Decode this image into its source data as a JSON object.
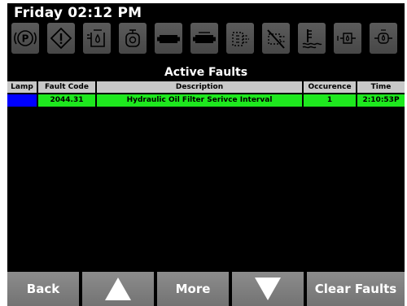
{
  "status": {
    "time": "Friday 02:12 PM"
  },
  "indicators": [
    {
      "name": "parking-brake-icon",
      "glyph": "(P)"
    },
    {
      "name": "warning-icon",
      "glyph": "!"
    },
    {
      "name": "hydraulic-oil-icon",
      "glyph": "hyd"
    },
    {
      "name": "engine-icon",
      "glyph": "eng"
    },
    {
      "name": "battery-icon",
      "glyph": "bat"
    },
    {
      "name": "battery-2-icon",
      "glyph": "bat"
    },
    {
      "name": "fuel-filter-icon",
      "glyph": "filter"
    },
    {
      "name": "no-regen-icon",
      "glyph": "x"
    },
    {
      "name": "coolant-temp-icon",
      "glyph": "temp"
    },
    {
      "name": "oil-pressure-icon",
      "glyph": "oil"
    },
    {
      "name": "oil-pressure-2-icon",
      "glyph": "oil"
    }
  ],
  "faults_view": {
    "title": "Active Faults",
    "columns": [
      "Lamp",
      "Fault Code",
      "Description",
      "Occurence",
      "Time"
    ],
    "rows": [
      {
        "lamp_color": "#0000ff",
        "fault_code": "2044.31",
        "description": "Hydraulic Oil Filter Serivce Interval",
        "occurrence": "1",
        "time": "2:10:53P"
      }
    ],
    "row_color": "#1ee81e"
  },
  "softkeys": {
    "back": "Back",
    "up": "up-arrow-icon",
    "more": "More",
    "down": "down-arrow-icon",
    "clear": "Clear Faults"
  }
}
